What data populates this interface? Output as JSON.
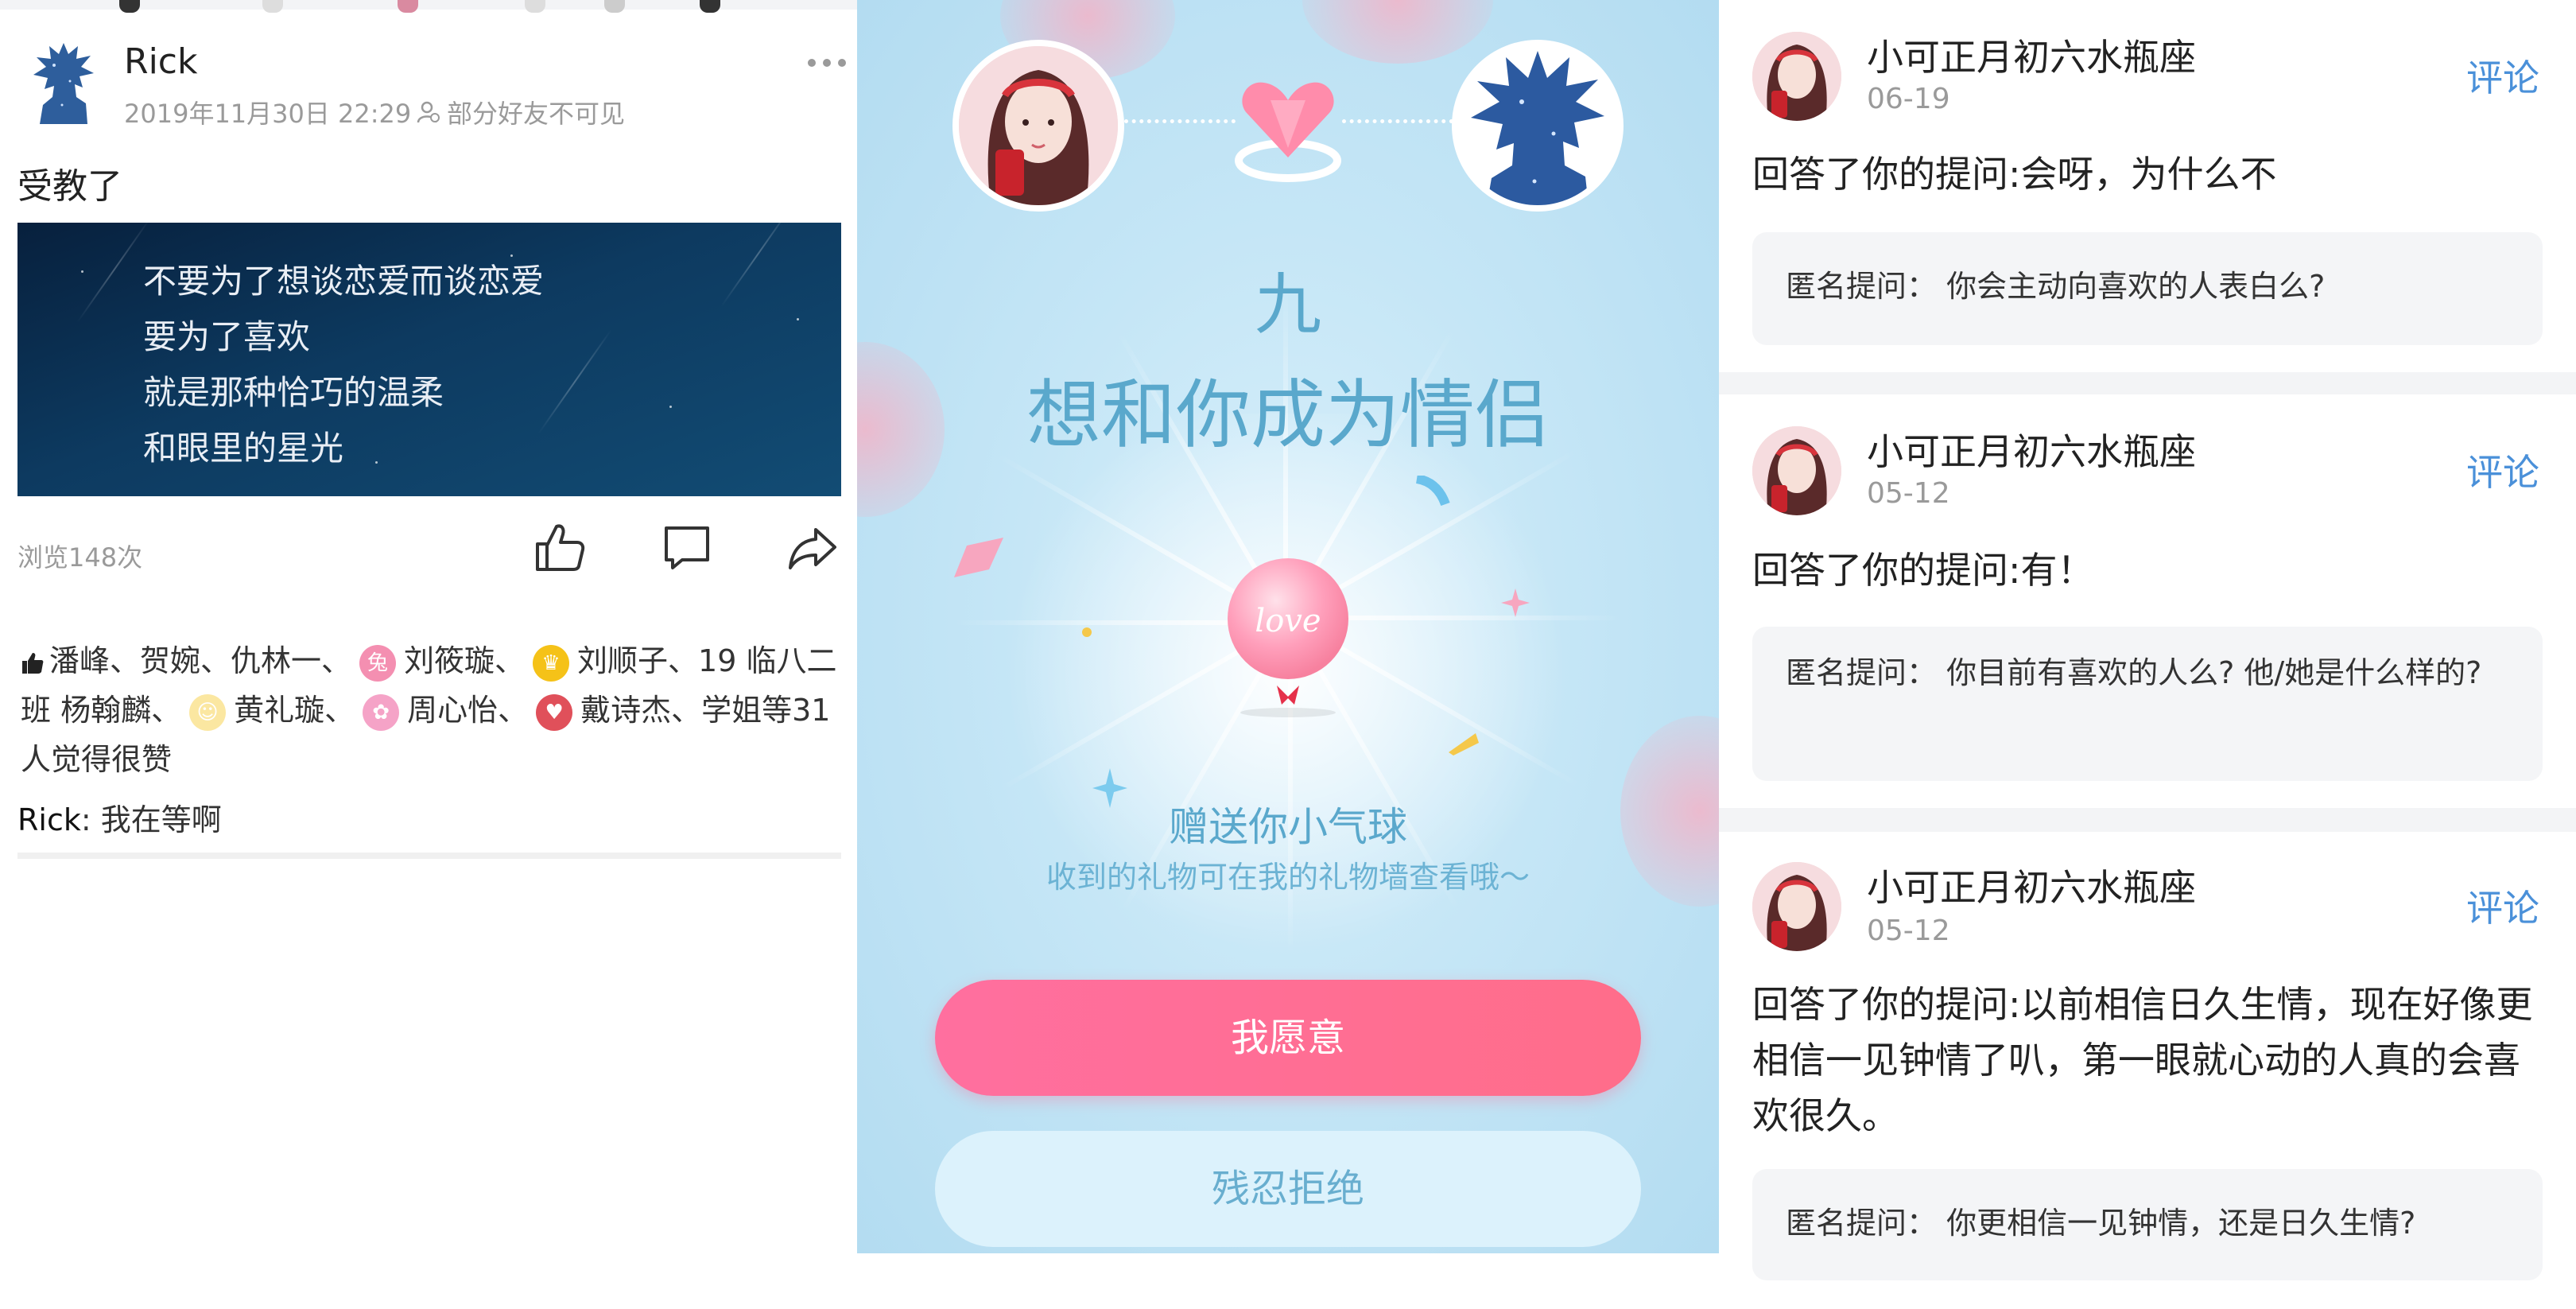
{
  "left": {
    "author": "Rick",
    "time": "2019年11月30日 22:29",
    "visibility": "部分好友不可见",
    "text": "受教了",
    "image_lines": [
      "不要为了想谈恋爱而谈恋爱",
      "要为了喜欢",
      "就是那种恰巧的温柔",
      "和眼里的星光"
    ],
    "views": "浏览148次",
    "likes": {
      "part1": "潘峰、贺婉、仇林一、",
      "name2": "刘筱璇、",
      "name3": "刘顺子、19 临八二",
      "part2": "班 杨翰麟、",
      "name4": "黄礼璇、",
      "name5": "周心怡、",
      "name6": "戴诗杰、学姐等31",
      "tail": "人觉得很赞"
    },
    "comment_author": "Rick",
    "comment_text": ": 我在等啊"
  },
  "middle": {
    "name": "九",
    "title": "想和你成为情侣",
    "balloon_text": "love",
    "gift_title": "赠送你小气球",
    "gift_sub": "收到的礼物可在我的礼物墙查看哦～",
    "accept": "我愿意",
    "reject": "残忍拒绝"
  },
  "right": {
    "cards": [
      {
        "user": "小可正月初六水瓶座",
        "date": "06-19",
        "comment": "评论",
        "answer": "回答了你的提问:会呀，为什么不",
        "question": "匿名提问：  你会主动向喜欢的人表白么?"
      },
      {
        "user": "小可正月初六水瓶座",
        "date": "05-12",
        "comment": "评论",
        "answer": "回答了你的提问:有！",
        "question": "匿名提问：  你目前有喜欢的人么? 他/她是什么样的?"
      },
      {
        "user": "小可正月初六水瓶座",
        "date": "05-12",
        "comment": "评论",
        "answer": "回答了你的提问:以前相信日久生情，现在好像更相信一见钟情了叭，第一眼就心动的人真的会喜欢很久。",
        "question": "匿名提问：  你更相信一见钟情，还是日久生情?"
      }
    ]
  },
  "colors": {
    "accent_blue": "#4a90d9",
    "mid_text": "#5aa8cc",
    "accept_pink": "#ff6f9f",
    "reject_bg": "#dcf2fc"
  }
}
